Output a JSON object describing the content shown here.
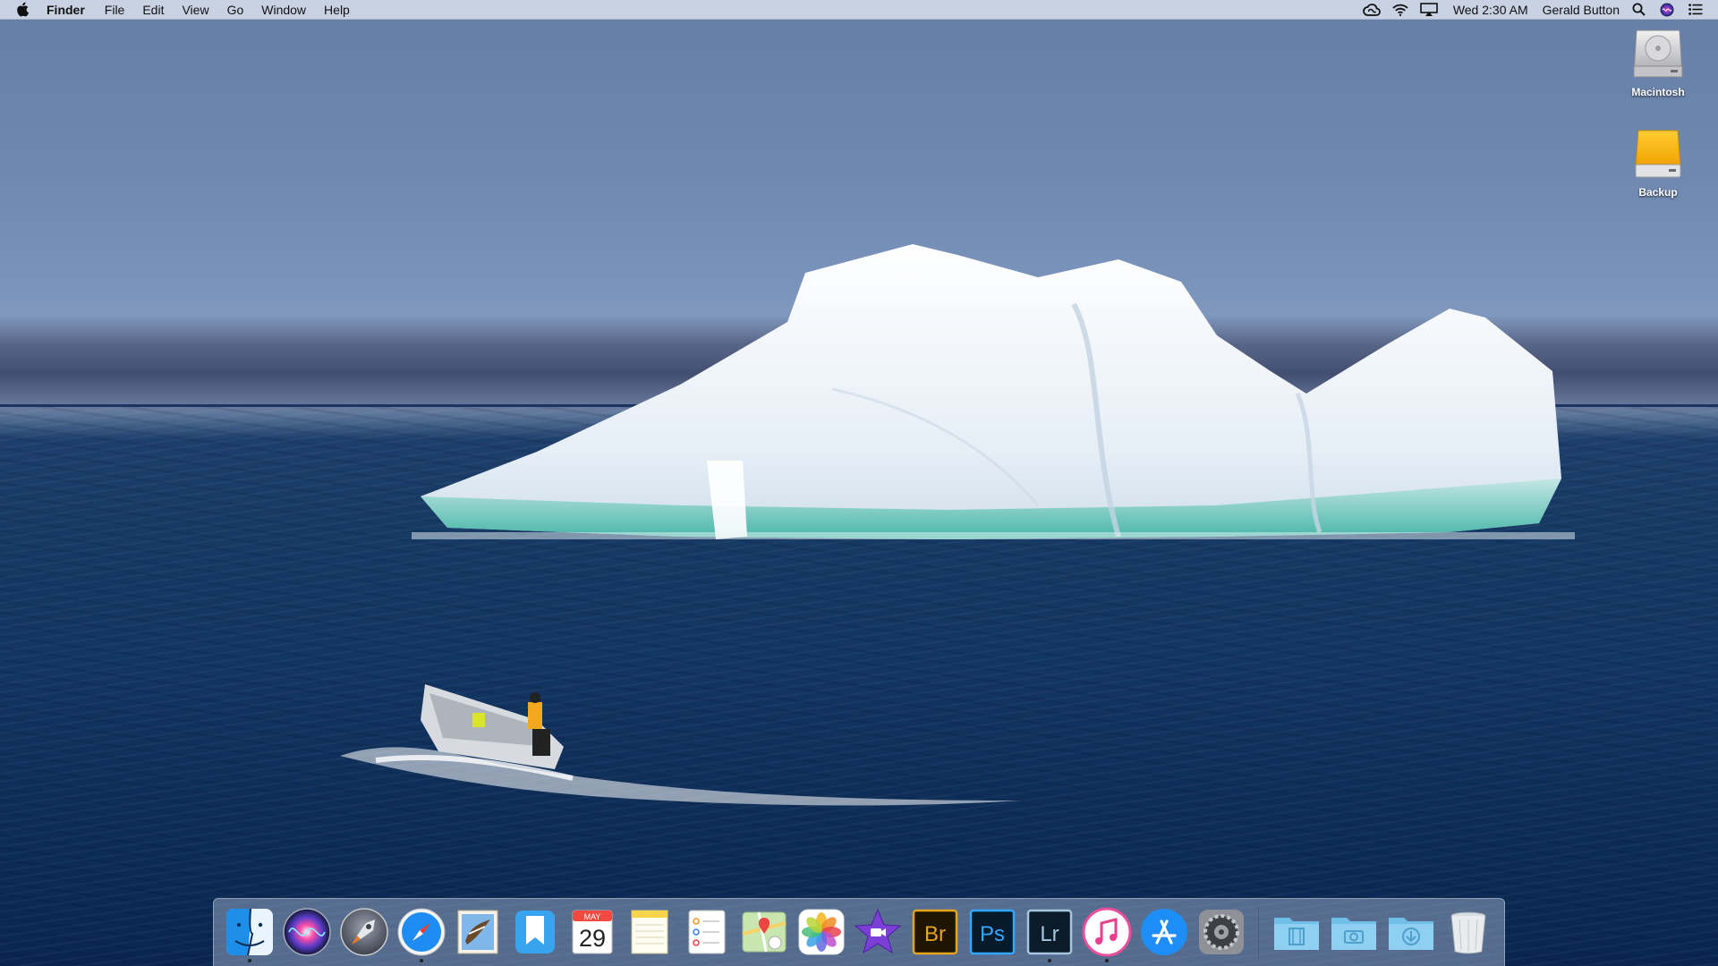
{
  "menubar": {
    "app_name": "Finder",
    "menus": [
      "File",
      "Edit",
      "View",
      "Go",
      "Window",
      "Help"
    ],
    "status_icons": [
      "creative-cloud-icon",
      "wifi-icon",
      "airplay-icon"
    ],
    "clock": "Wed 2:30 AM",
    "user_name": "Gerald Button",
    "right_icons": [
      "spotlight-icon",
      "siri-icon",
      "notification-center-icon"
    ]
  },
  "desktop_icons": [
    {
      "label": "Macintosh",
      "icon": "hard-drive-icon"
    },
    {
      "label": "Backup",
      "icon": "external-drive-icon"
    }
  ],
  "dock": {
    "apps": [
      {
        "name": "Finder",
        "icon": "finder-icon",
        "running": true
      },
      {
        "name": "Siri",
        "icon": "siri-icon",
        "running": false
      },
      {
        "name": "Launchpad",
        "icon": "launchpad-icon",
        "running": false
      },
      {
        "name": "Safari",
        "icon": "safari-icon",
        "running": true
      },
      {
        "name": "Mail",
        "icon": "mail-icon",
        "running": false
      },
      {
        "name": "Day One",
        "icon": "bookmark-icon",
        "running": false
      },
      {
        "name": "Calendar",
        "icon": "calendar-icon",
        "running": false,
        "month": "MAY",
        "day": "29"
      },
      {
        "name": "Notes",
        "icon": "notes-icon",
        "running": false
      },
      {
        "name": "Reminders",
        "icon": "reminders-icon",
        "running": false
      },
      {
        "name": "Maps",
        "icon": "maps-icon",
        "running": false
      },
      {
        "name": "Photos",
        "icon": "photos-icon",
        "running": false
      },
      {
        "name": "iMovie",
        "icon": "imovie-icon",
        "running": false
      },
      {
        "name": "Bridge",
        "icon": "bridge-icon",
        "running": false,
        "text": "Br"
      },
      {
        "name": "Photoshop",
        "icon": "photoshop-icon",
        "running": false,
        "text": "Ps"
      },
      {
        "name": "Lightroom",
        "icon": "lightroom-icon",
        "running": true,
        "text": "Lr"
      },
      {
        "name": "iTunes",
        "icon": "itunes-icon",
        "running": true
      },
      {
        "name": "App Store",
        "icon": "app-store-icon",
        "running": false
      },
      {
        "name": "System Preferences",
        "icon": "system-preferences-icon",
        "running": false
      }
    ],
    "folders": [
      {
        "name": "Movies",
        "icon": "movies-folder-icon"
      },
      {
        "name": "Pictures",
        "icon": "pictures-folder-icon"
      },
      {
        "name": "Downloads",
        "icon": "downloads-folder-icon"
      },
      {
        "name": "Trash",
        "icon": "trash-icon"
      }
    ]
  },
  "colors": {
    "menubar_bg": "#d6deec",
    "sky_top": "#647ea6",
    "sea": "#123561",
    "ice": "#f2f6fb",
    "ice_shadow": "#2fae9c"
  }
}
